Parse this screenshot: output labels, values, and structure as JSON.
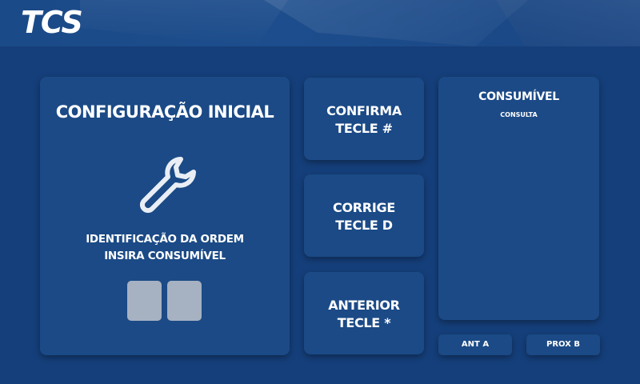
{
  "header": {
    "logo_text": "TCS"
  },
  "main_panel": {
    "title": "CONFIGURAÇÃO INICIAL",
    "icon": "wrench-icon",
    "instruction_line1": "IDENTIFICAÇÃO DA ORDEM",
    "instruction_line2": "INSIRA CONSUMÍVEL",
    "input_slots": [
      "",
      ""
    ]
  },
  "keys": [
    {
      "line1": "CONFIRMA",
      "line2": "TECLE #"
    },
    {
      "line1": "CORRIGE",
      "line2": "TECLE D"
    },
    {
      "line1": "ANTERIOR",
      "line2": "TECLE *"
    }
  ],
  "side_panel": {
    "title": "CONSUMÍVEL",
    "subtitle": "CONSULTA",
    "prev_label": "ANT A",
    "next_label": "PROX B"
  },
  "colors": {
    "background": "#153f7a",
    "card": "#1b4a86",
    "slot": "#a6b1c2",
    "text": "#ffffff"
  }
}
